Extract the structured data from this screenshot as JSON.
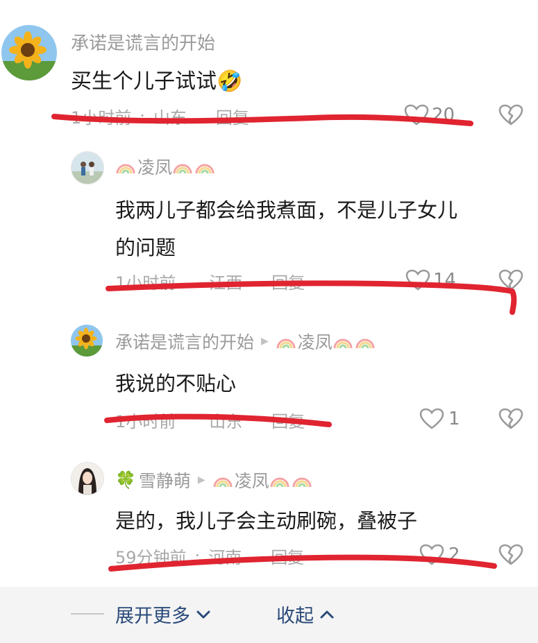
{
  "thread": {
    "main": {
      "author": "承诺是谎言的开始",
      "text": "买生个儿子试试",
      "emoji": "🤣",
      "time": "1小时前",
      "location": "山东",
      "reply": "回复",
      "likes": "20"
    },
    "replies": [
      {
        "author": "凌凤",
        "text_line1": "我两儿子都会给我煮面，不是儿子女儿",
        "text_line2": "的问题",
        "time": "1小时前",
        "location": "江西",
        "reply": "回复",
        "likes": "14"
      },
      {
        "author": "承诺是谎言的开始",
        "reply_to": "凌凤",
        "text": "我说的不贴心",
        "time": "1小时前",
        "location": "山东",
        "reply": "回复",
        "likes": "1"
      },
      {
        "author": "雪静萌",
        "reply_to": "凌凤",
        "text": "是的，我儿子会主动刷碗，叠被子",
        "time": "59分钟前",
        "location": "河南",
        "reply": "回复",
        "likes": "2"
      }
    ]
  },
  "footer": {
    "expand_label": "展开更多",
    "collapse_label": "收起"
  },
  "colors": {
    "annotation_red": "#e02430",
    "footer_link": "#2a4a7a",
    "rainbow": [
      "#f5a3a3",
      "#f7d58a",
      "#a8d8a0",
      "#9ec8ef"
    ]
  },
  "icons": [
    "heart-outline-icon",
    "broken-heart-icon",
    "rainbow-icon",
    "clover-icon",
    "chevron-down-icon",
    "chevron-up-icon",
    "triangle-right-icon"
  ]
}
